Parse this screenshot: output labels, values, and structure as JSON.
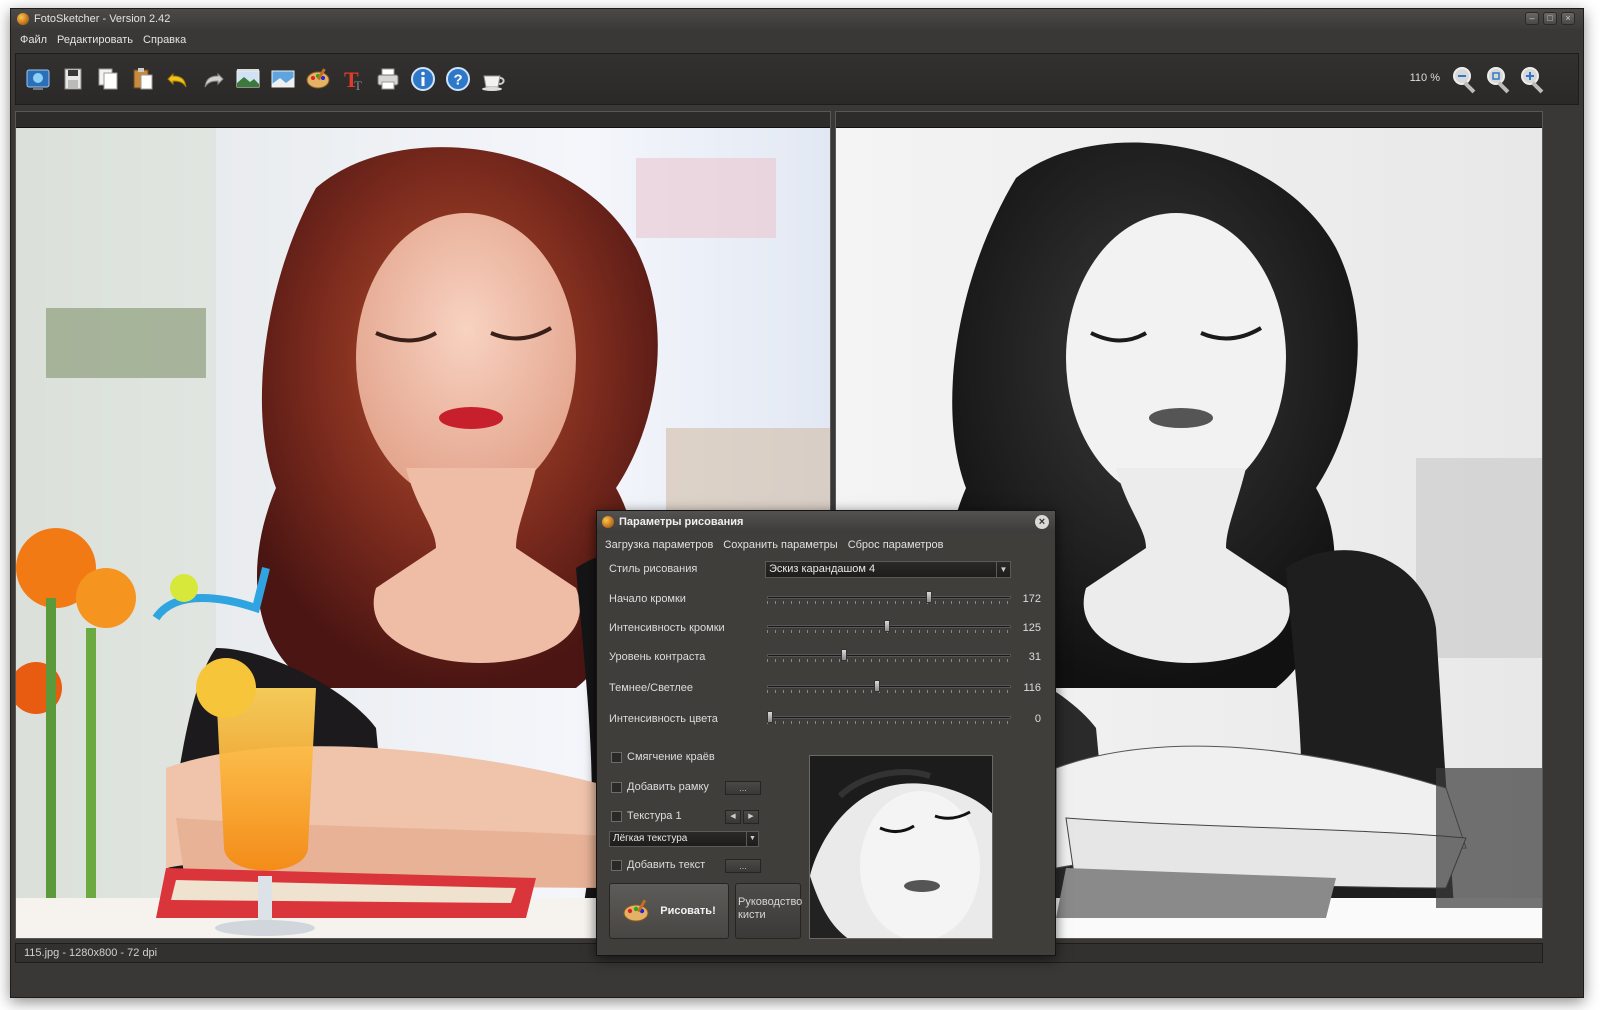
{
  "window": {
    "title": "FotoSketcher - Version 2.42",
    "controls": [
      "–",
      "□",
      "×"
    ]
  },
  "menu": [
    "Файл",
    "Редактировать",
    "Справка"
  ],
  "toolbar": {
    "icons": [
      "open-image-icon",
      "save-icon",
      "copy-icon",
      "paste-icon",
      "undo-icon",
      "redo-icon",
      "batch-icon",
      "image-size-icon",
      "palette-icon",
      "text-icon",
      "print-icon",
      "info-icon",
      "help-icon",
      "coffee-icon"
    ],
    "zoom_label": "110 %",
    "zoom_icons": [
      "zoom-out-icon",
      "zoom-fit-icon",
      "zoom-in-icon"
    ]
  },
  "status": {
    "text": "115.jpg - 1280x800 - 72 dpi"
  },
  "dialog": {
    "title": "Параметры рисования",
    "menu": [
      "Загрузка параметров",
      "Сохранить параметры",
      "Сброс параметров"
    ],
    "style_label": "Стиль рисования",
    "style_value": "Эскиз карандашом 4",
    "sliders": [
      {
        "label": "Начало кромки",
        "value": "172",
        "fraction": 0.67
      },
      {
        "label": "Интенсивность кромки",
        "value": "125",
        "fraction": 0.49
      },
      {
        "label": "Уровень контраста",
        "value": "31",
        "fraction": 0.31
      },
      {
        "label": "Темнее/Светлее",
        "value": "116",
        "fraction": 0.45
      },
      {
        "label": "Интенсивность цвета",
        "value": "0",
        "fraction": 0.0
      }
    ],
    "checks": {
      "smooth": "Смягчение краёв",
      "frame": "Добавить рамку",
      "texture": "Текстура 1",
      "text": "Добавить текст"
    },
    "ellipsis": "...",
    "texture_value": "Лёгкая текстура",
    "draw_button": "Рисовать!",
    "guide_button": "Руководство кисти"
  }
}
